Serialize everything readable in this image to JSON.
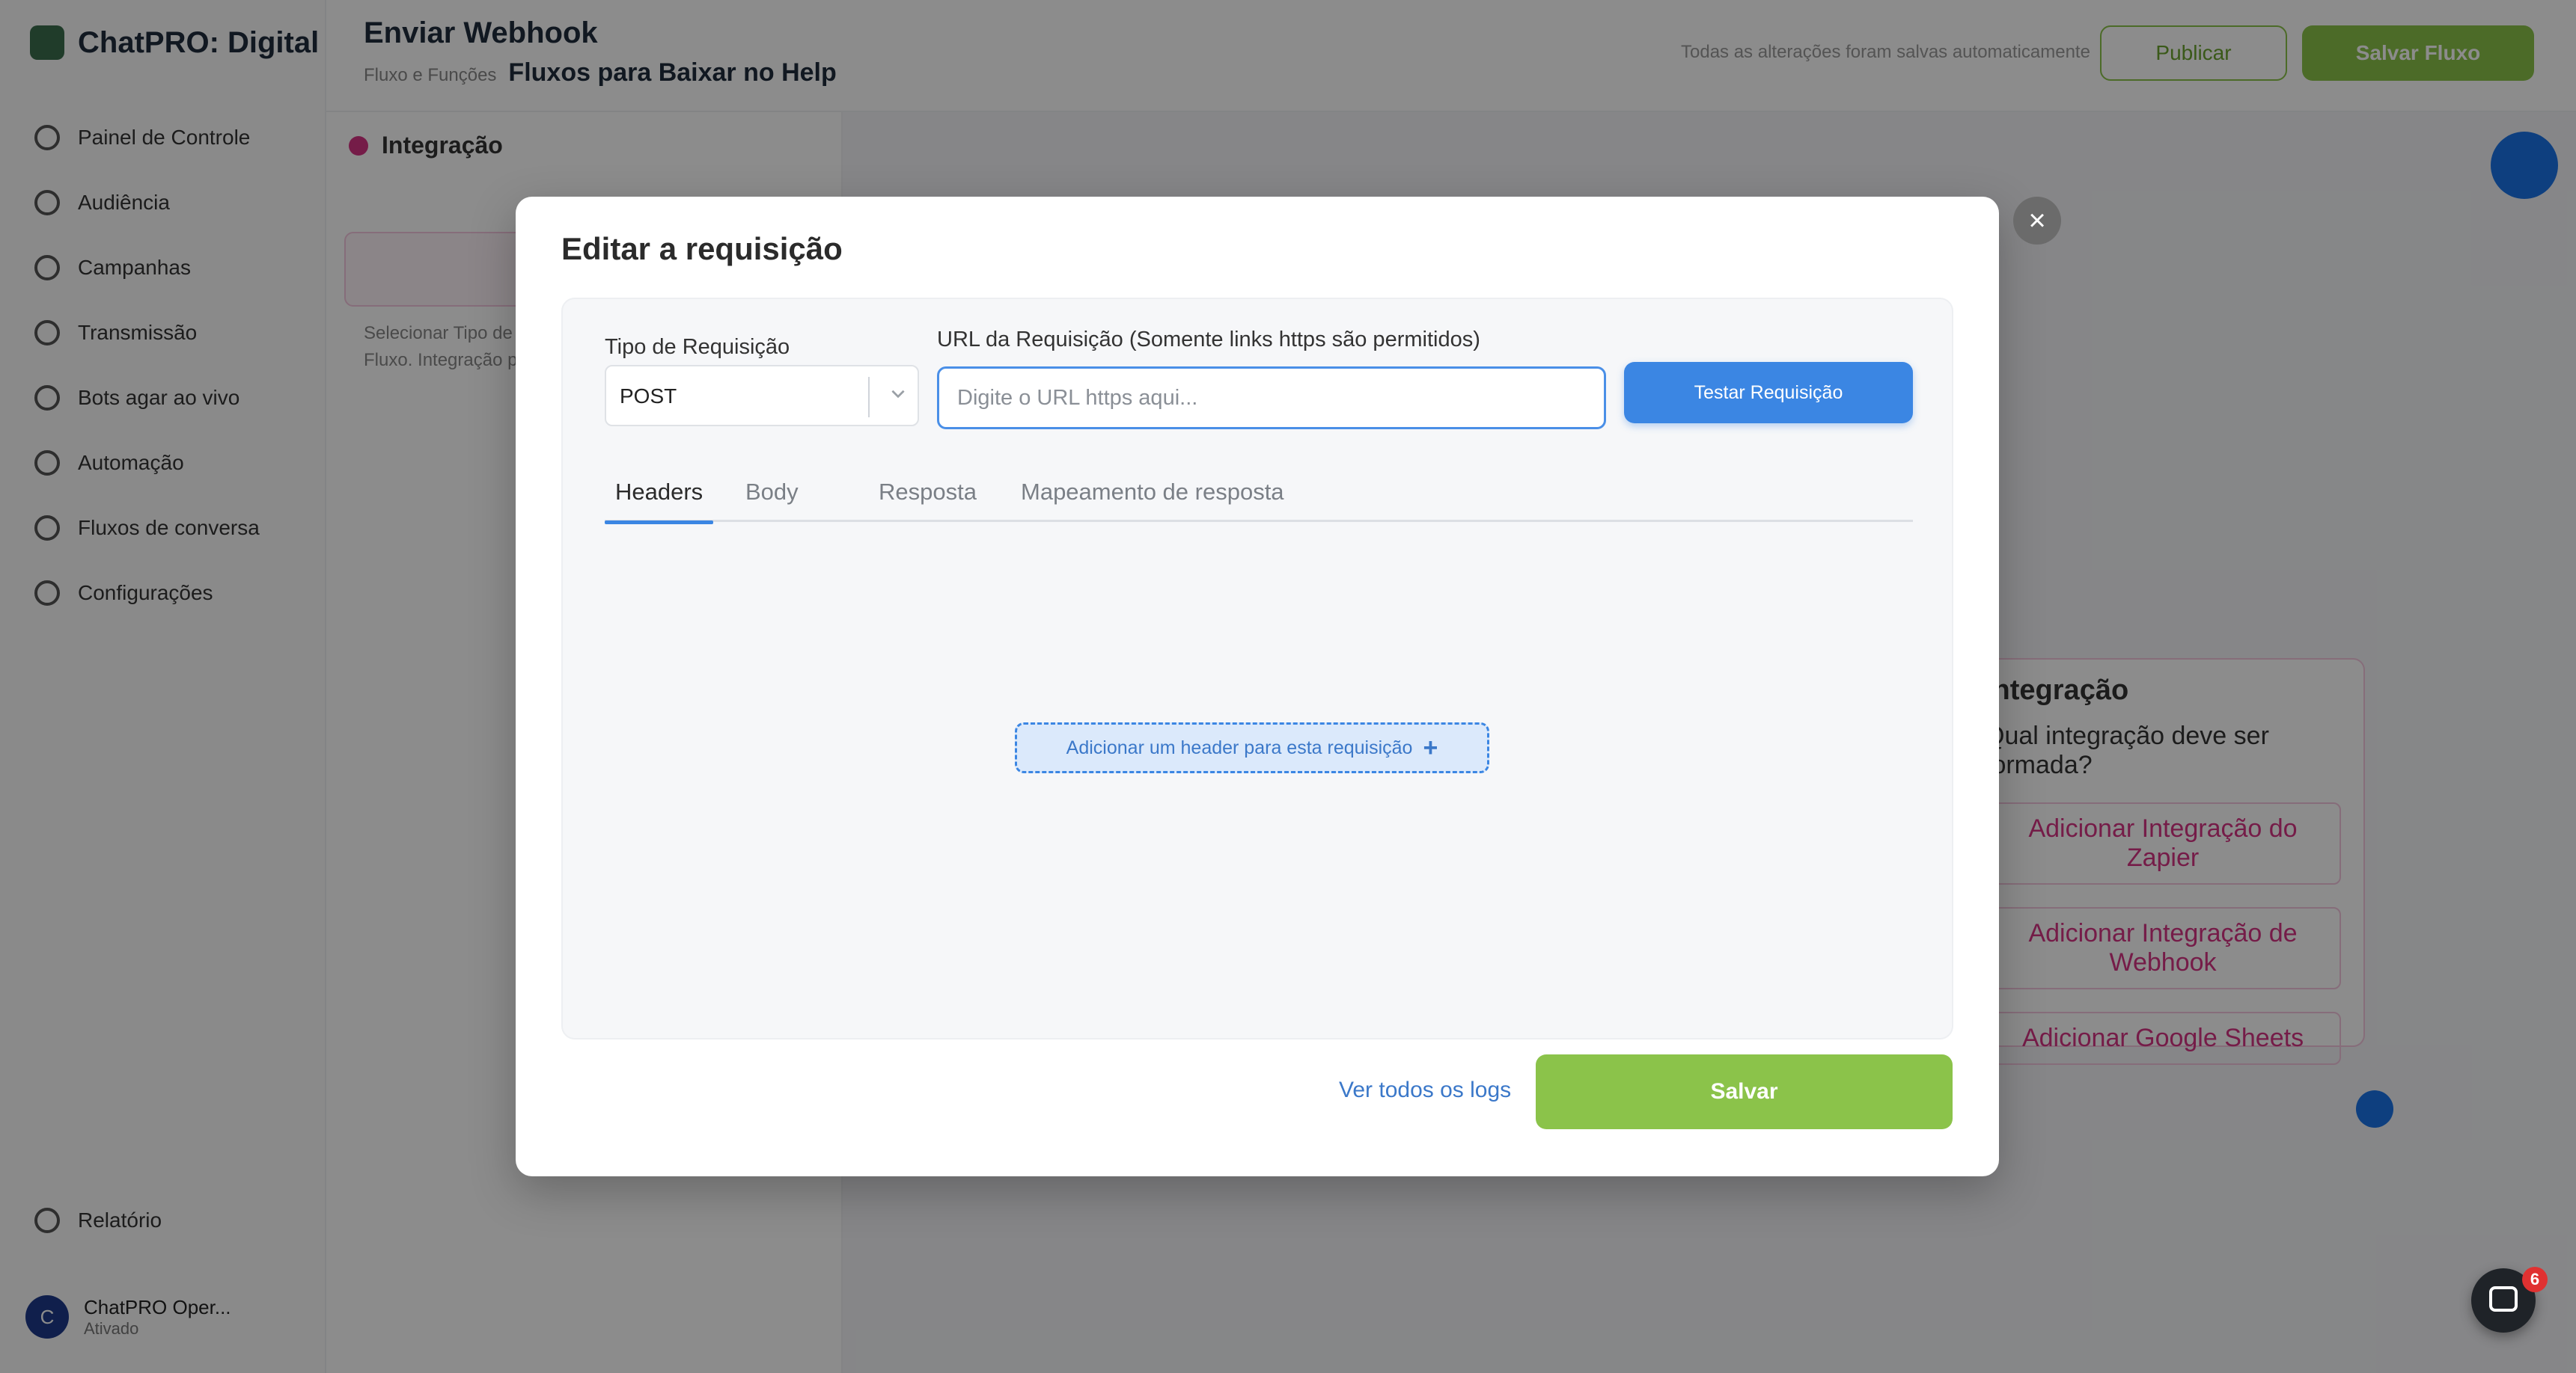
{
  "background": {
    "brand": "ChatPRO: Digital",
    "nav_items": [
      "Painel de Controle",
      "Audiência",
      "Campanhas",
      "Transmissão",
      "Bots agar ao vivo",
      "Automação",
      "Fluxos de conversa",
      "Configurações"
    ],
    "nav_bottom": "Relatório",
    "profile": {
      "initial": "C",
      "name": "ChatPRO Oper...",
      "sub": "Ativado"
    },
    "topbar": {
      "title": "Enviar Webhook",
      "crumb_prefix": "Fluxo e Funções",
      "crumb_current": "Fluxos para Baixar no Help",
      "note": "Todas as alterações foram salvas automaticamente",
      "outline_button": "Publicar",
      "green_button": "Salvar Fluxo"
    },
    "panel": {
      "title": "Integração",
      "text": "Selecionar Tipo de Integração que será feita ao Fluxo. Integração por Webhook."
    },
    "card": {
      "title": "Integração",
      "question": "Qual integração deve ser formada?",
      "options": [
        "Adicionar Integração do Zapier",
        "Adicionar Integração de Webhook",
        "Adicionar Google Sheets"
      ]
    }
  },
  "modal": {
    "title": "Editar a requisição",
    "close_label": "×",
    "request_type_label": "Tipo de Requisição",
    "request_type_value": "POST",
    "url_label": "URL da Requisição (Somente links https são permitidos)",
    "url_placeholder": "Digite o URL https aqui...",
    "url_value": "",
    "test_button": "Testar Requisição",
    "tabs": [
      "Headers",
      "Body",
      "Resposta",
      "Mapeamento de resposta"
    ],
    "active_tab": "Headers",
    "add_header_button": "Adicionar um header para esta requisição",
    "add_icon": "+",
    "logs_link": "Ver todos os logs",
    "save_button": "Salvar"
  },
  "chat_widget": {
    "badge_count": "6"
  },
  "colors": {
    "primary_blue": "#3b86e3",
    "save_green": "#8bc34a",
    "overlay": "rgba(0,0,0,0.45)"
  }
}
